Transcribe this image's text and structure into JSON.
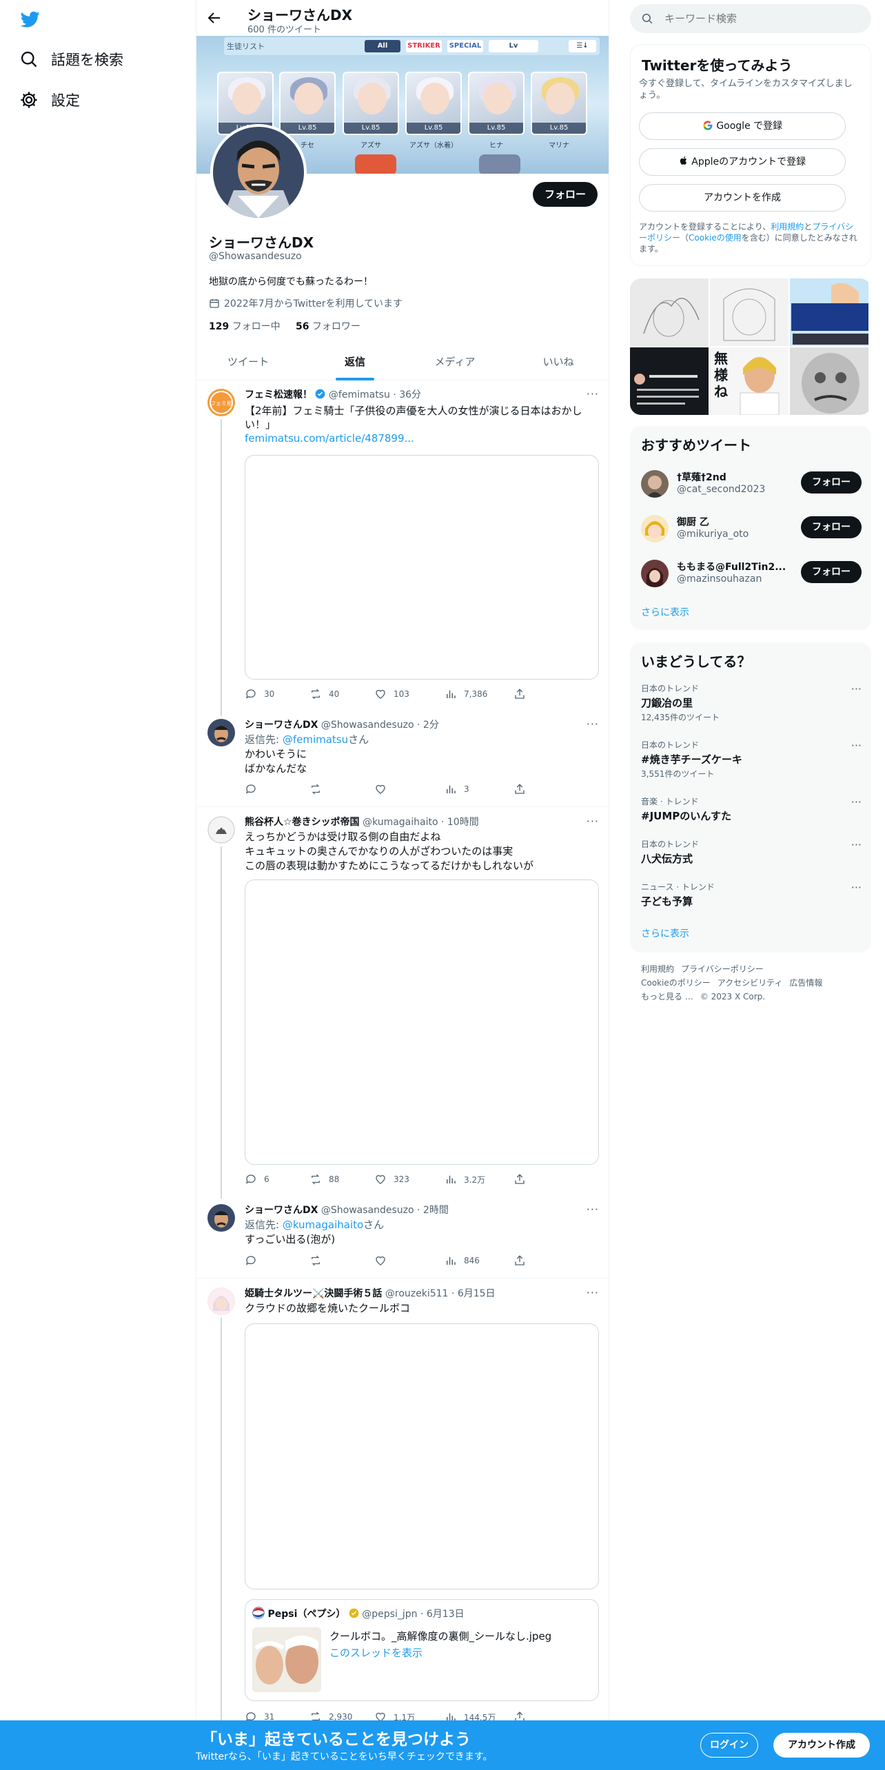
{
  "nav": {
    "explore": "話題を検索",
    "settings": "設定"
  },
  "header": {
    "name": "ショーワさんDX",
    "tweet_count": "600 件のツイート"
  },
  "banner": {
    "label": "生徒リスト",
    "tabs": [
      "All",
      "STRIKER",
      "SPECIAL",
      "Lv",
      "☰↓"
    ],
    "cards": [
      {
        "lv": "Lv.85",
        "name": ""
      },
      {
        "lv": "Lv.85",
        "name": "チセ"
      },
      {
        "lv": "Lv.85",
        "name": "アズサ"
      },
      {
        "lv": "Lv.85",
        "name": "アズサ（水着）"
      },
      {
        "lv": "Lv.85",
        "name": "ヒナ"
      },
      {
        "lv": "Lv.85",
        "name": "マリナ"
      }
    ]
  },
  "profile": {
    "name": "ショーワさんDX",
    "handle": "@Showasandesuzo",
    "bio": "地獄の底から何度でも蘇ったるわー！",
    "joined": "2022年7月からTwitterを利用しています",
    "following_count": "129",
    "following_label": "フォロー中",
    "followers_count": "56",
    "followers_label": "フォロワー",
    "follow_button": "フォロー"
  },
  "tabs": [
    "ツイート",
    "返信",
    "メディア",
    "いいね"
  ],
  "tweets": [
    {
      "name": "フェミ松速報！",
      "handle": "@femimatsu",
      "time": "· 36分",
      "text1": "【2年前】フェミ騎士「子供役の声優を大人の女性が演じる日本はおかしい！」",
      "link": "femimatsu.com/article/487899...",
      "reply": "30",
      "retweet": "40",
      "like": "103",
      "views": "7,386"
    },
    {
      "name": "ショーワさんDX",
      "handle": "@Showasandesuzo",
      "time": "· 2分",
      "reply_prefix": "返信先: ",
      "reply_to": "@femimatsu",
      "reply_suffix": "さん",
      "text1": "かわいそうに",
      "text2": "ばかなんだな",
      "views": "3"
    },
    {
      "name": "熊谷杯人☆巻きシッポ帝国",
      "handle": "@kumagaihaito",
      "time": "· 10時間",
      "text1": "えっちかどうかは受け取る側の自由だよね",
      "text2": "キュキュットの奥さんでかなりの人がざわついたのは事実",
      "text3": "この唇の表現は動かすためにこうなってるだけかもしれないが",
      "reply": "6",
      "retweet": "88",
      "like": "323",
      "views": "3.2万"
    },
    {
      "name": "ショーワさんDX",
      "handle": "@Showasandesuzo",
      "time": "· 2時間",
      "reply_prefix": "返信先: ",
      "reply_to": "@kumagaihaito",
      "reply_suffix": "さん",
      "text1": "すっごい出る(泡が)",
      "views": "846"
    },
    {
      "name": "姫騎士タルツー⚔️決闘手術５話",
      "handle": "@rouzeki511",
      "time": "· 6月15日",
      "text1": "クラウドの故郷を焼いたクールボコ",
      "quote_name": "Pepsi（ペプシ）",
      "quote_handle": "@pepsi_jpn",
      "quote_time": "· 6月13日",
      "quote_text": "クールボコ。_高解像度の裏側_シールなし.jpeg",
      "quote_link": "このスレッドを表示",
      "reply": "31",
      "retweet": "2,930",
      "like": "1.1万",
      "views": "144.5万"
    }
  ],
  "right": {
    "search_placeholder": "キーワード検索",
    "signup": {
      "title": "Twitterを使ってみよう",
      "sub": "今すぐ登録して、タイムラインをカスタマイズしましょう。",
      "google": "Google で登録",
      "apple": "Appleのアカウントで登録",
      "create": "アカウントを作成",
      "legal1": "アカウントを登録することにより、",
      "tos": "利用規約",
      "legal2": "と",
      "privacy": "プライバシーポリシー",
      "legal3": "（",
      "cookie": "Cookieの使用",
      "legal4": "を含む）に同意したとみなされます。"
    },
    "rec_title": "おすすめツイート",
    "recs": [
      {
        "name": "†草薙†2nd",
        "handle": "@cat_second2023",
        "btn": "フォロー"
      },
      {
        "name": "御厨 乙",
        "handle": "@mikuriya_oto",
        "btn": "フォロー"
      },
      {
        "name": "ももまる@Full2Tin2...",
        "handle": "@mazinsouhazan",
        "btn": "フォロー"
      }
    ],
    "show_more": "さらに表示",
    "trend_title": "いまどうしてる？",
    "trends": [
      {
        "cat": "日本のトレンド",
        "title": "刀鍛冶の里",
        "count": "12,435件のツイート"
      },
      {
        "cat": "日本のトレンド",
        "title": "#焼き芋チーズケーキ",
        "count": "3,551件のツイート"
      },
      {
        "cat": "音楽 · トレンド",
        "title": "#JUMPのいんすた",
        "count": ""
      },
      {
        "cat": "日本のトレンド",
        "title": "八犬伝方式",
        "count": ""
      },
      {
        "cat": "ニュース · トレンド",
        "title": "子ども予算",
        "count": ""
      }
    ],
    "gallery_text": "無様ね",
    "footer": [
      "利用規約",
      "プライバシーポリシー",
      "Cookieのポリシー",
      "アクセシビリティ",
      "広告情報",
      "もっと見る …",
      "© 2023 X Corp."
    ]
  },
  "bottom": {
    "title": "「いま」起きていることを見つけよう",
    "sub": "Twitterなら、「いま」起きていることをいち早くチェックできます。",
    "login": "ログイン",
    "signup": "アカウント作成"
  },
  "colors": {
    "accent": "#1d9bf0",
    "text": "#0f1419",
    "muted": "#536471"
  }
}
